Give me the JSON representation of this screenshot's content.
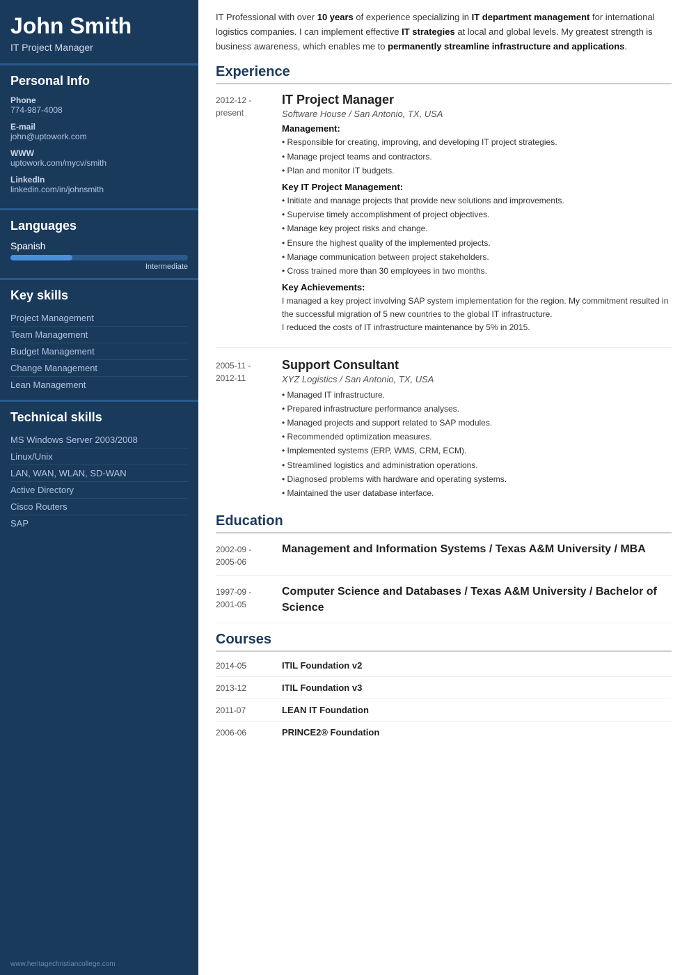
{
  "sidebar": {
    "name": "John Smith",
    "title": "IT Project Manager",
    "sections": {
      "personal_info_label": "Personal Info",
      "phone_label": "Phone",
      "phone_value": "774-987-4008",
      "email_label": "E-mail",
      "email_value": "john@uptowork.com",
      "www_label": "WWW",
      "www_value": "uptowork.com/mycv/smith",
      "linkedin_label": "LinkedIn",
      "linkedin_value": "linkedin.com/in/johnsmith"
    },
    "languages_label": "Languages",
    "languages": [
      {
        "name": "Spanish",
        "level": "Intermediate",
        "percent": 35
      }
    ],
    "keyskills_label": "Key skills",
    "key_skills": [
      "Project Management",
      "Team Management",
      "Budget Management",
      "Change Management",
      "Lean Management"
    ],
    "technical_label": "Technical skills",
    "technical_skills": [
      "MS Windows Server 2003/2008",
      "Linux/Unix",
      "LAN, WAN, WLAN, SD-WAN",
      "Active Directory",
      "Cisco Routers",
      "SAP"
    ],
    "footer": "www.heritagechristiancollege.com"
  },
  "main": {
    "summary": "IT Professional with over 10 years of experience specializing in IT department management for international logistics companies. I can implement effective IT strategies at local and global levels. My greatest strength is business awareness, which enables me to permanently streamline infrastructure and applications.",
    "experience_label": "Experience",
    "experience": [
      {
        "date": "2012-12 -\npresent",
        "job_title": "IT Project Manager",
        "company": "Software House / San Antonio, TX, USA",
        "sections": [
          {
            "label": "Management:",
            "bullets": [
              "• Responsible for creating, improving, and developing IT project strategies.",
              "• Manage project teams and contractors.",
              "• Plan and monitor IT budgets."
            ]
          },
          {
            "label": "Key IT Project Management:",
            "bullets": [
              "• Initiate and manage projects that provide new solutions and improvements.",
              "• Supervise timely accomplishment of project objectives.",
              "• Manage key project risks and change.",
              "• Ensure the highest quality of the implemented projects.",
              "• Manage communication between project stakeholders.",
              "• Cross trained more than 30 employees in two months."
            ]
          },
          {
            "label": "Key Achievements:",
            "bullets": [],
            "achievements": [
              "I managed a key project involving SAP system implementation for the region. My commitment resulted in the successful migration of 5 new countries to the global IT infrastructure.",
              "I reduced the costs of IT infrastructure maintenance by 5% in 2015."
            ]
          }
        ]
      },
      {
        "date": "2005-11 -\n2012-11",
        "job_title": "Support Consultant",
        "company": "XYZ Logistics / San Antonio, TX, USA",
        "sections": [
          {
            "label": "",
            "bullets": [
              "• Managed IT infrastructure.",
              "• Prepared infrastructure performance analyses.",
              "• Managed projects and support related to SAP modules.",
              "• Recommended optimization measures.",
              "• Implemented systems (ERP, WMS, CRM, ECM).",
              "• Streamlined logistics and administration operations.",
              "• Diagnosed problems with hardware and operating systems.",
              "• Maintained the user database interface."
            ]
          }
        ]
      }
    ],
    "education_label": "Education",
    "education": [
      {
        "date": "2002-09 -\n2005-06",
        "degree": "Management and Information Systems / Texas A&M University / MBA"
      },
      {
        "date": "1997-09 -\n2001-05",
        "degree": "Computer Science and Databases / Texas A&M University / Bachelor of Science"
      }
    ],
    "courses_label": "Courses",
    "courses": [
      {
        "date": "2014-05",
        "name": "ITIL Foundation v2"
      },
      {
        "date": "2013-12",
        "name": "ITIL Foundation v3"
      },
      {
        "date": "2011-07",
        "name": "LEAN IT Foundation"
      },
      {
        "date": "2006-06",
        "name": "PRINCE2® Foundation"
      }
    ]
  }
}
